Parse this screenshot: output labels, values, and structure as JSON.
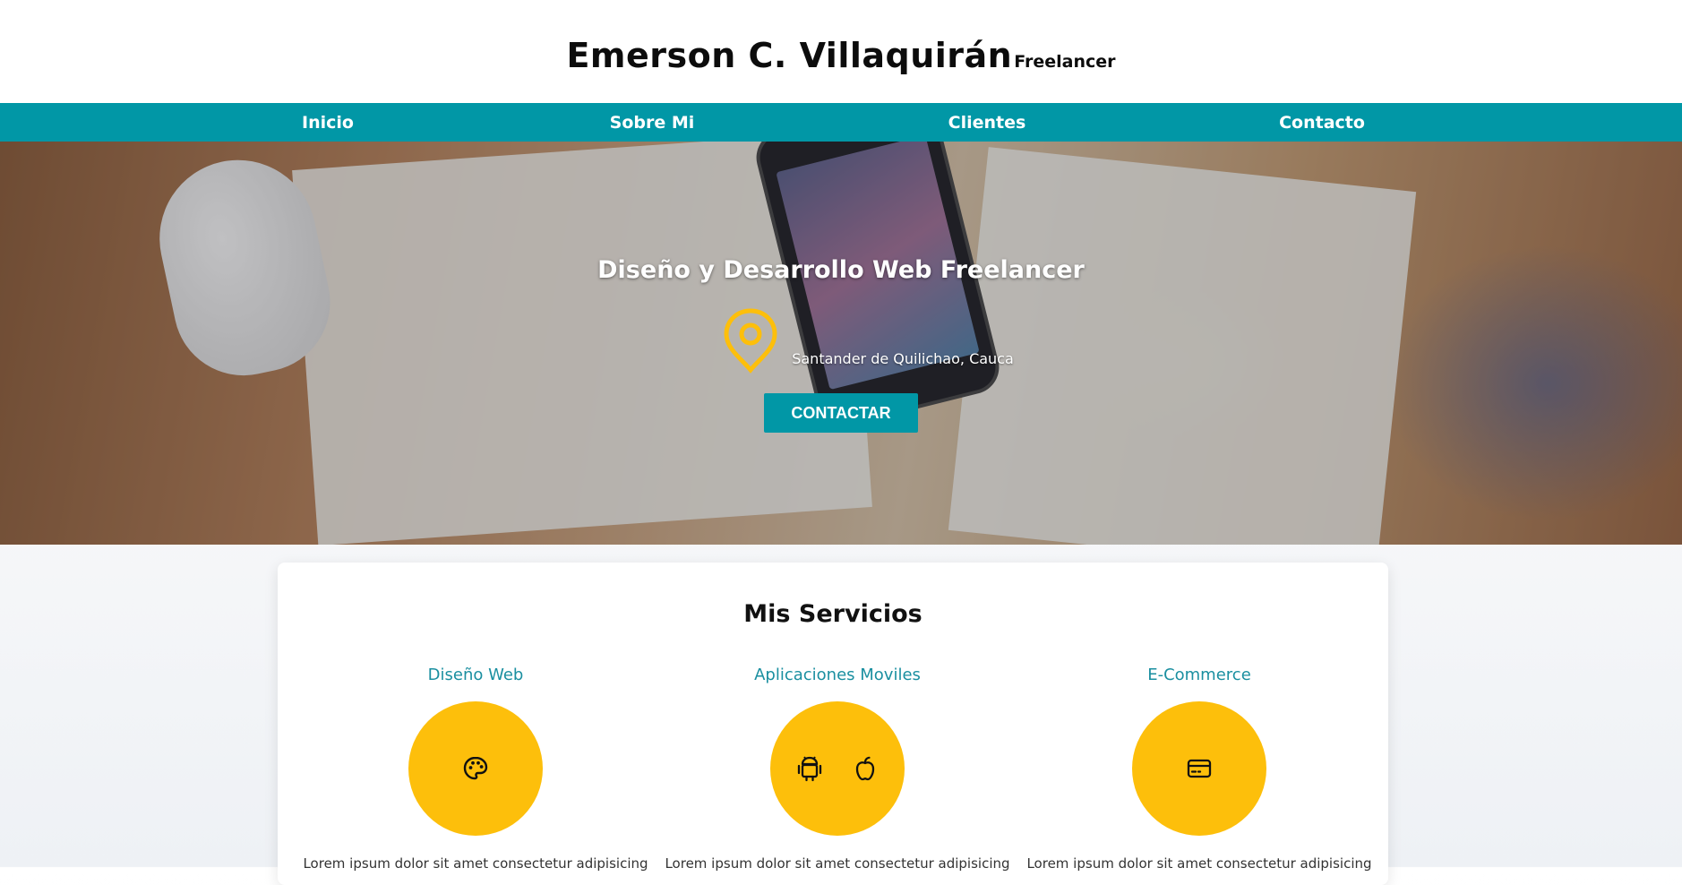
{
  "header": {
    "name": "Emerson C. Villaquirán",
    "tagline": "Freelancer"
  },
  "nav": {
    "items": [
      {
        "label": "Inicio"
      },
      {
        "label": "Sobre Mi"
      },
      {
        "label": "Clientes"
      },
      {
        "label": "Contacto"
      }
    ]
  },
  "hero": {
    "title": "Diseño y Desarrollo Web Freelancer",
    "location": "Santander de Quilichao, Cauca",
    "location_icon": "map-pin-icon",
    "cta_label": "CONTACTAR"
  },
  "services": {
    "title": "Mis Servicios",
    "items": [
      {
        "title": "Diseño Web",
        "icons": [
          "palette-icon"
        ],
        "description": "Lorem ipsum dolor sit amet consectetur adipisicing"
      },
      {
        "title": "Aplicaciones Moviles",
        "icons": [
          "android-icon",
          "apple-icon"
        ],
        "description": "Lorem ipsum dolor sit amet consectetur adipisicing"
      },
      {
        "title": "E-Commerce",
        "icons": [
          "credit-card-icon"
        ],
        "description": "Lorem ipsum dolor sit amet consectetur adipisicing"
      }
    ]
  },
  "colors": {
    "primary": "#0197a6",
    "accent": "#fdbf0b",
    "service_title": "#1a8fa0"
  }
}
